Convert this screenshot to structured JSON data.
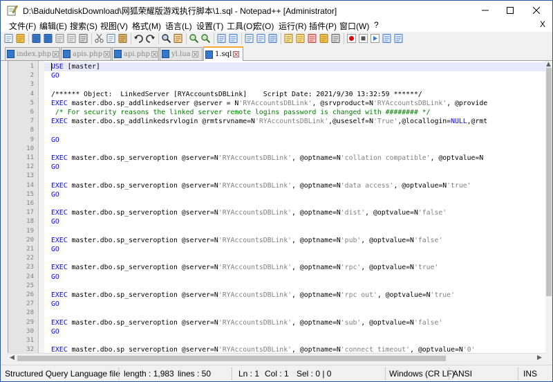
{
  "window": {
    "title": "D:\\BaiduNetdiskDownload\\网狐荣耀版游戏执行脚本\\1.sql - Notepad++ [Administrator]",
    "minimize_glyph": "—",
    "maximize_glyph": "☐",
    "close_glyph": "✕"
  },
  "menu": {
    "items": [
      "文件(F)",
      "编辑(E)",
      "搜索(S)",
      "视图(V)",
      "格式(M)",
      "语言(L)",
      "设置(T)",
      "工具(O)",
      "宏(O)",
      "运行(R)",
      "插件(P)",
      "窗口(W)",
      "?"
    ],
    "close_label": "X"
  },
  "toolbar": {
    "icons": [
      "new-file-icon",
      "open-file-icon",
      "save-icon",
      "save-all-icon",
      "close-icon",
      "close-all-icon",
      "print-icon",
      "cut-icon",
      "copy-icon",
      "paste-icon",
      "undo-icon",
      "redo-icon",
      "find-icon",
      "replace-icon",
      "zoom-in-icon",
      "zoom-out-icon",
      "sync-vertical-icon",
      "sync-horizontal-icon",
      "word-wrap-icon",
      "show-all-chars-icon",
      "indent-guide-icon",
      "language-icon",
      "doc-map-icon",
      "function-list-icon",
      "folder-workspace-icon",
      "monitor-icon",
      "record-macro-icon",
      "stop-record-icon",
      "play-macro-icon",
      "run-macro-multiple-icon",
      "save-macro-icon"
    ]
  },
  "tabs": [
    {
      "label": "index.php",
      "active": false
    },
    {
      "label": "apis.php",
      "active": false
    },
    {
      "label": "api.php",
      "active": false
    },
    {
      "label": "yl.lua",
      "active": false
    },
    {
      "label": "1.sql",
      "active": true
    }
  ],
  "editor": {
    "line_numbers": [
      "1",
      "2",
      "3",
      "4",
      "5",
      "6",
      "7",
      "8",
      "9",
      "10",
      "11",
      "12",
      "13",
      "14",
      "15",
      "16",
      "17",
      "18",
      "19",
      "20",
      "21",
      "22",
      "23",
      "24",
      "25",
      "26",
      "27",
      "28",
      "29",
      "30",
      "31",
      "32"
    ],
    "lines": [
      [
        {
          "t": "USE [master]",
          "c": "mixed-use"
        }
      ],
      [
        {
          "t": "GO",
          "c": "kw"
        }
      ],
      [
        {
          "t": "",
          "c": ""
        }
      ],
      [
        {
          "t": "/****** Object:  LinkedServer [RYAccountsDBLink]    Script Date: 2021/9/30 13:32:59 ******/",
          "c": ""
        }
      ],
      [
        {
          "t": "EXEC",
          "c": "kw"
        },
        {
          "t": " master.dbo.sp_addlinkedserver @server = N",
          "c": ""
        },
        {
          "t": "'RYAccountsDBLink'",
          "c": "str"
        },
        {
          "t": ", @srvproduct=N",
          "c": ""
        },
        {
          "t": "'RYAccountsDBLink'",
          "c": "str"
        },
        {
          "t": ", @provide",
          "c": ""
        }
      ],
      [
        {
          "t": " /* For security reasons the linked server remote logins password is changed with ######## */",
          "c": "cmt"
        }
      ],
      [
        {
          "t": "EXEC",
          "c": "kw"
        },
        {
          "t": " master.dbo.sp_addlinkedsrvlogin @rmtsrvname=N",
          "c": ""
        },
        {
          "t": "'RYAccountsDBLink'",
          "c": "str"
        },
        {
          "t": ",@useself=N",
          "c": ""
        },
        {
          "t": "'True'",
          "c": "str"
        },
        {
          "t": ",@locallogin=",
          "c": ""
        },
        {
          "t": "NULL",
          "c": "kw"
        },
        {
          "t": ",@rmt",
          "c": ""
        }
      ],
      [
        {
          "t": "",
          "c": ""
        }
      ],
      [
        {
          "t": "GO",
          "c": "kw"
        }
      ],
      [
        {
          "t": "",
          "c": ""
        }
      ],
      [
        {
          "t": "EXEC",
          "c": "kw"
        },
        {
          "t": " master.dbo.sp_serveroption @server=N",
          "c": ""
        },
        {
          "t": "'RYAccountsDBLink'",
          "c": "str"
        },
        {
          "t": ", @optname=N",
          "c": ""
        },
        {
          "t": "'collation compatible'",
          "c": "str"
        },
        {
          "t": ", @optvalue=N",
          "c": ""
        }
      ],
      [
        {
          "t": "GO",
          "c": "kw"
        }
      ],
      [
        {
          "t": "",
          "c": ""
        }
      ],
      [
        {
          "t": "EXEC",
          "c": "kw"
        },
        {
          "t": " master.dbo.sp_serveroption @server=N",
          "c": ""
        },
        {
          "t": "'RYAccountsDBLink'",
          "c": "str"
        },
        {
          "t": ", @optname=N",
          "c": ""
        },
        {
          "t": "'data access'",
          "c": "str"
        },
        {
          "t": ", @optvalue=N",
          "c": ""
        },
        {
          "t": "'true'",
          "c": "str"
        }
      ],
      [
        {
          "t": "GO",
          "c": "kw"
        }
      ],
      [
        {
          "t": "",
          "c": ""
        }
      ],
      [
        {
          "t": "EXEC",
          "c": "kw"
        },
        {
          "t": " master.dbo.sp_serveroption @server=N",
          "c": ""
        },
        {
          "t": "'RYAccountsDBLink'",
          "c": "str"
        },
        {
          "t": ", @optname=N",
          "c": ""
        },
        {
          "t": "'dist'",
          "c": "str"
        },
        {
          "t": ", @optvalue=N",
          "c": ""
        },
        {
          "t": "'false'",
          "c": "str"
        }
      ],
      [
        {
          "t": "GO",
          "c": "kw"
        }
      ],
      [
        {
          "t": "",
          "c": ""
        }
      ],
      [
        {
          "t": "EXEC",
          "c": "kw"
        },
        {
          "t": " master.dbo.sp_serveroption @server=N",
          "c": ""
        },
        {
          "t": "'RYAccountsDBLink'",
          "c": "str"
        },
        {
          "t": ", @optname=N",
          "c": ""
        },
        {
          "t": "'pub'",
          "c": "str"
        },
        {
          "t": ", @optvalue=N",
          "c": ""
        },
        {
          "t": "'false'",
          "c": "str"
        }
      ],
      [
        {
          "t": "GO",
          "c": "kw"
        }
      ],
      [
        {
          "t": "",
          "c": ""
        }
      ],
      [
        {
          "t": "EXEC",
          "c": "kw"
        },
        {
          "t": " master.dbo.sp_serveroption @server=N",
          "c": ""
        },
        {
          "t": "'RYAccountsDBLink'",
          "c": "str"
        },
        {
          "t": ", @optname=N",
          "c": ""
        },
        {
          "t": "'rpc'",
          "c": "str"
        },
        {
          "t": ", @optvalue=N",
          "c": ""
        },
        {
          "t": "'true'",
          "c": "str"
        }
      ],
      [
        {
          "t": "GO",
          "c": "kw"
        }
      ],
      [
        {
          "t": "",
          "c": ""
        }
      ],
      [
        {
          "t": "EXEC",
          "c": "kw"
        },
        {
          "t": " master.dbo.sp_serveroption @server=N",
          "c": ""
        },
        {
          "t": "'RYAccountsDBLink'",
          "c": "str"
        },
        {
          "t": ", @optname=N",
          "c": ""
        },
        {
          "t": "'rpc out'",
          "c": "str"
        },
        {
          "t": ", @optvalue=N",
          "c": ""
        },
        {
          "t": "'true'",
          "c": "str"
        }
      ],
      [
        {
          "t": "GO",
          "c": "kw"
        }
      ],
      [
        {
          "t": "",
          "c": ""
        }
      ],
      [
        {
          "t": "EXEC",
          "c": "kw"
        },
        {
          "t": " master.dbo.sp_serveroption @server=N",
          "c": ""
        },
        {
          "t": "'RYAccountsDBLink'",
          "c": "str"
        },
        {
          "t": ", @optname=N",
          "c": ""
        },
        {
          "t": "'sub'",
          "c": "str"
        },
        {
          "t": ", @optvalue=N",
          "c": ""
        },
        {
          "t": "'false'",
          "c": "str"
        }
      ],
      [
        {
          "t": "GO",
          "c": "kw"
        }
      ],
      [
        {
          "t": "",
          "c": ""
        }
      ],
      [
        {
          "t": "EXEC",
          "c": "kw"
        },
        {
          "t": " master.dbo.sp_serveroption @server=N",
          "c": ""
        },
        {
          "t": "'RYAccountsDBLink'",
          "c": "str"
        },
        {
          "t": ", @optname=N",
          "c": ""
        },
        {
          "t": "'connect timeout'",
          "c": "str"
        },
        {
          "t": ", @optvalue=N",
          "c": ""
        },
        {
          "t": "'0'",
          "c": "str"
        }
      ]
    ]
  },
  "colors": {
    "keyword": "#0000ff",
    "string": "#808080",
    "comment": "#008000",
    "current_line": "#e8e8ff",
    "active_tab_accent": "#f8a73b"
  },
  "status": {
    "filetype": "Structured Query Language file",
    "length": "length : 1,983",
    "lines": "lines : 50",
    "ln": "Ln : 1",
    "col": "Col : 1",
    "sel": "Sel : 0 | 0",
    "eol": "Windows (CR LF)",
    "encoding": "ANSI",
    "mode": "INS"
  }
}
